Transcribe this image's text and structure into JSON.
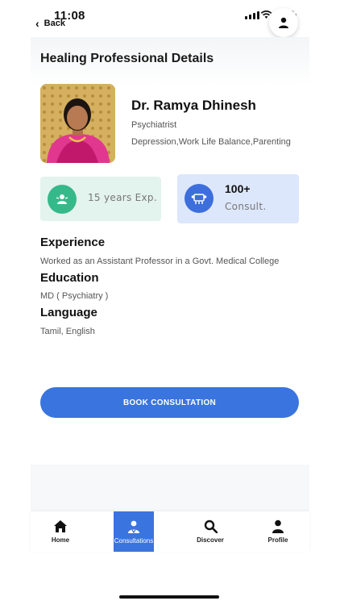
{
  "status": {
    "time": "11:08",
    "back_label": "Back"
  },
  "page": {
    "title": "Healing Professional Details"
  },
  "doctor": {
    "name": "Dr. Ramya Dhinesh",
    "specialty": "Psychiatrist",
    "focus_areas": "Depression,Work Life Balance,Parenting"
  },
  "stats": {
    "experience": "15 years Exp.",
    "consultations_count": "100+",
    "consultations_label": "Consult."
  },
  "sections": {
    "experience": {
      "heading": "Experience",
      "text": "Worked as an Assistant Professor in a Govt. Medical College"
    },
    "education": {
      "heading": "Education",
      "text": "MD ( Psychiatry )"
    },
    "language": {
      "heading": "Language",
      "text": "Tamil, English"
    }
  },
  "cta": {
    "book_label": "BOOK CONSULTATION"
  },
  "tabs": [
    {
      "label": "Home",
      "icon": "home-icon"
    },
    {
      "label": "Consultations",
      "icon": "consultations-icon"
    },
    {
      "label": "Discover",
      "icon": "search-icon"
    },
    {
      "label": "Profile",
      "icon": "profile-icon"
    }
  ],
  "colors": {
    "primary": "#3a74df",
    "experience_card_bg": "#e3f3ee",
    "experience_icon_bg": "#35b98a",
    "consult_card_bg": "#dde7fb",
    "battery_low": "#e53935"
  }
}
